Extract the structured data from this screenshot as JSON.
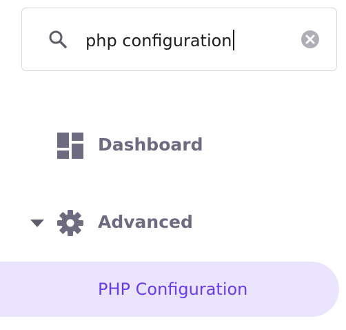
{
  "search": {
    "value": "php configuration",
    "icon": "search-icon",
    "clear_icon": "clear-icon"
  },
  "nav": {
    "items": [
      {
        "label": "Dashboard",
        "icon": "dashboard-icon"
      },
      {
        "label": "Advanced",
        "icon": "gear-icon",
        "expanded": true,
        "children": [
          {
            "label": "PHP Configuration",
            "selected": true
          }
        ]
      }
    ]
  },
  "colors": {
    "text_primary": "#1d1e20",
    "nav_text": "#6d6b80",
    "accent": "#673de6",
    "selected_bg": "#ebe4ff",
    "border": "#d6d6dd",
    "icon_gray": "#5c5d66"
  }
}
